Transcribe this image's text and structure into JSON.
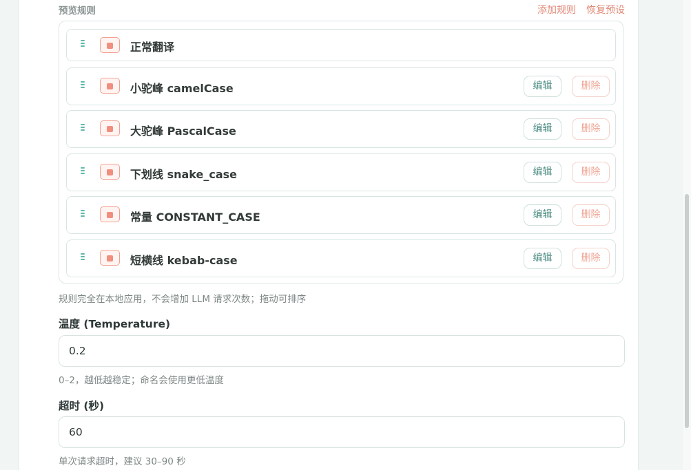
{
  "section": {
    "title": "预览规则",
    "add_label": "添加规则",
    "reset_label": "恢复预设"
  },
  "rules": [
    {
      "name": "正常翻译",
      "editable": false
    },
    {
      "name": "小驼峰 camelCase",
      "editable": true
    },
    {
      "name": "大驼峰 PascalCase",
      "editable": true
    },
    {
      "name": "下划线 snake_case",
      "editable": true
    },
    {
      "name": "常量 CONSTANT_CASE",
      "editable": true
    },
    {
      "name": "短横线 kebab-case",
      "editable": true
    }
  ],
  "rule_actions": {
    "edit_label": "编辑",
    "delete_label": "删除"
  },
  "rules_hint": "规则完全在本地应用，不会增加 LLM 请求次数；拖动可排序",
  "temperature": {
    "label": "温度 (Temperature)",
    "value": "0.2",
    "hint": "0–2，越低越稳定；命名会使用更低温度"
  },
  "timeout": {
    "label": "超时 (秒)",
    "value": "60",
    "hint": "单次请求超时，建议 30–90 秒"
  },
  "colors": {
    "accent": "#5fb8a8",
    "danger": "#e28a78"
  }
}
